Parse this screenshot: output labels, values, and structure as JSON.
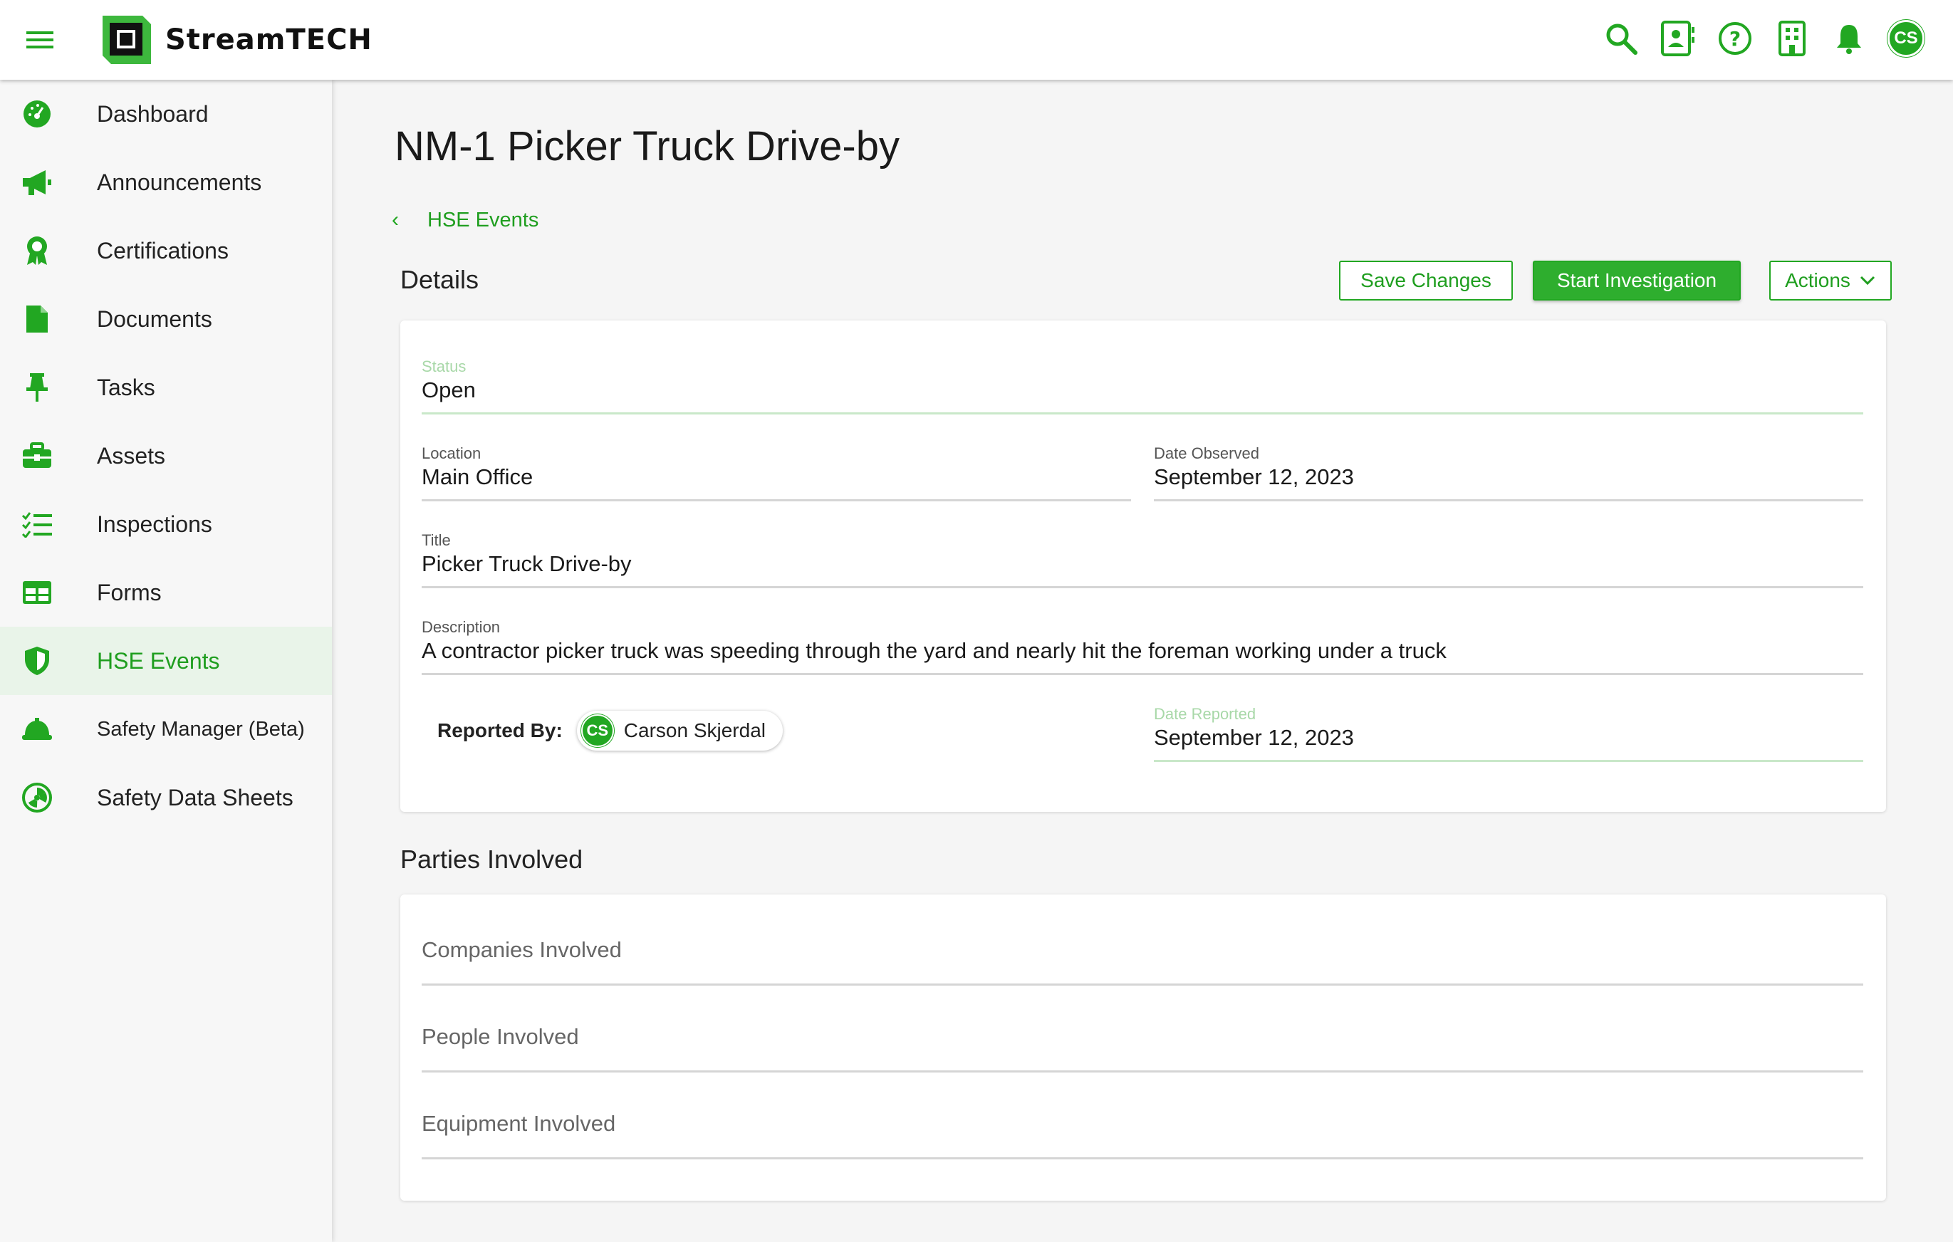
{
  "header": {
    "brand": "StreamTECH",
    "user_initials": "CS",
    "icons": [
      "search-icon",
      "contact-card-icon",
      "help-icon",
      "building-icon",
      "bell-icon"
    ]
  },
  "sidebar": {
    "items": [
      {
        "label": "Dashboard",
        "icon": "dashboard-icon"
      },
      {
        "label": "Announcements",
        "icon": "megaphone-icon"
      },
      {
        "label": "Certifications",
        "icon": "certificate-icon"
      },
      {
        "label": "Documents",
        "icon": "document-icon"
      },
      {
        "label": "Tasks",
        "icon": "pin-icon"
      },
      {
        "label": "Assets",
        "icon": "toolbox-icon"
      },
      {
        "label": "Inspections",
        "icon": "checklist-icon"
      },
      {
        "label": "Forms",
        "icon": "table-icon"
      },
      {
        "label": "HSE Events",
        "icon": "shield-icon",
        "active": true
      },
      {
        "label": "Safety Manager (Beta)",
        "icon": "hardhat-icon"
      },
      {
        "label": "Safety Data Sheets",
        "icon": "hazard-icon"
      }
    ]
  },
  "page": {
    "title": "NM-1 Picker Truck Drive-by",
    "breadcrumb": "HSE Events"
  },
  "details": {
    "heading": "Details",
    "save_label": "Save Changes",
    "start_label": "Start Investigation",
    "actions_label": "Actions",
    "status_label": "Status",
    "status_value": "Open",
    "location_label": "Location",
    "location_value": "Main Office",
    "date_observed_label": "Date Observed",
    "date_observed_value": "September 12, 2023",
    "title_label": "Title",
    "title_value": "Picker Truck Drive-by",
    "description_label": "Description",
    "description_value": "A contractor picker truck was speeding through the yard and nearly hit the foreman working under a truck",
    "reported_by_label": "Reported By:",
    "reporter_initials": "CS",
    "reporter_name": "Carson Skjerdal",
    "date_reported_label": "Date Reported",
    "date_reported_value": "September 12, 2023"
  },
  "parties": {
    "heading": "Parties Involved",
    "companies": "Companies Involved",
    "people": "People Involved",
    "equipment": "Equipment Involved"
  },
  "colors": {
    "accent": "#22a722",
    "accent_text": "#1f9e1f",
    "active_bg": "#e9f4e9"
  }
}
